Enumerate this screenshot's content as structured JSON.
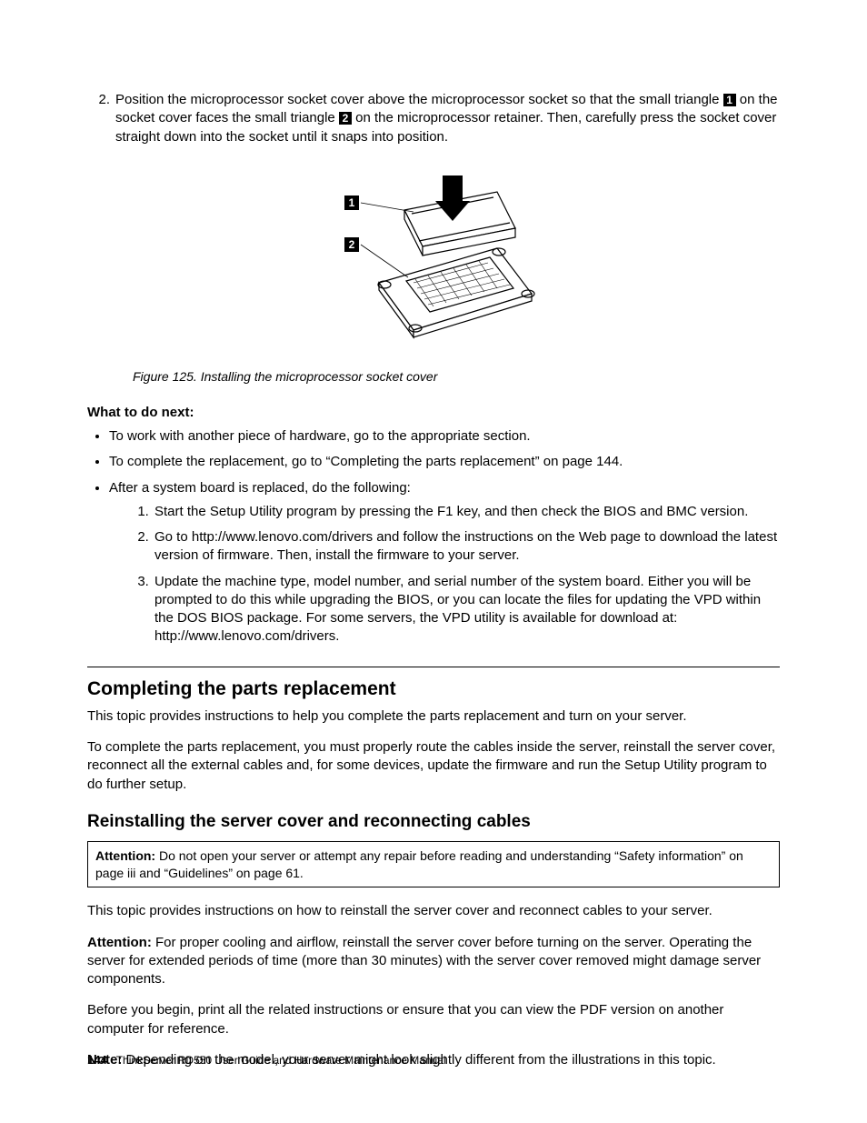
{
  "step2": {
    "num": "2.",
    "part1": "Position the microprocessor socket cover above the microprocessor socket so that the small triangle ",
    "c1": "1",
    "part2": " on the socket cover faces the small triangle ",
    "c2": "2",
    "part3": " on the microprocessor retainer. Then, carefully press the socket cover straight down into the socket until it snaps into position."
  },
  "figure": {
    "caption": "Figure 125. Installing the microprocessor socket cover",
    "callout1": "1",
    "callout2": "2"
  },
  "next": {
    "heading": "What to do next:",
    "b1": "To work with another piece of hardware, go to the appropriate section.",
    "b2": "To complete the replacement, go to “Completing the parts replacement” on page 144.",
    "b3": "After a system board is replaced, do the following:",
    "s1": "Start the Setup Utility program by pressing the F1 key, and then check the BIOS and BMC version.",
    "s2": "Go to http://www.lenovo.com/drivers and follow the instructions on the Web page to download the latest version of firmware. Then, install the firmware to your server.",
    "s3": "Update the machine type, model number, and serial number of the system board. Either you will be prompted to do this while upgrading the BIOS, or you can locate the files for updating the VPD within the DOS BIOS package. For some servers, the VPD utility is available for download at: http://www.lenovo.com/drivers."
  },
  "completing": {
    "title": "Completing the parts replacement",
    "p1": "This topic provides instructions to help you complete the parts replacement and turn on your server.",
    "p2": "To complete the parts replacement, you must properly route the cables inside the server, reinstall the server cover, reconnect all the external cables and, for some devices, update the firmware and run the Setup Utility program to do further setup."
  },
  "reinstall": {
    "title": "Reinstalling the server cover and reconnecting cables",
    "att_label": "Attention:",
    "att_body": " Do not open your server or attempt any repair before reading and understanding “Safety information” on page iii and “Guidelines” on page 61.",
    "p1": "This topic provides instructions on how to reinstall the server cover and reconnect cables to your server.",
    "att2_label": "Attention:",
    "att2_body": " For proper cooling and airflow, reinstall the server cover before turning on the server. Operating the server for extended periods of time (more than 30 minutes) with the server cover removed might damage server components.",
    "p2": "Before you begin, print all the related instructions or ensure that you can view the PDF version on another computer for reference.",
    "note_label": "Note:",
    "note_body": " Depending on the model, your server might look slightly different from the illustrations in this topic."
  },
  "footer": {
    "pagenum": "144",
    "title": "ThinkServer RD550 User Guide and Hardware Maintenance Manual"
  }
}
